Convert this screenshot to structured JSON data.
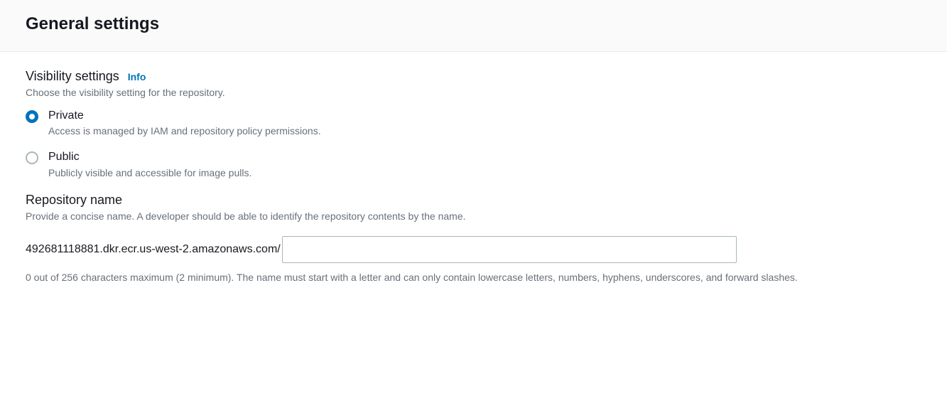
{
  "header": {
    "title": "General settings"
  },
  "visibility": {
    "label": "Visibility settings",
    "info_link": "Info",
    "description": "Choose the visibility setting for the repository.",
    "options": [
      {
        "label": "Private",
        "description": "Access is managed by IAM and repository policy permissions.",
        "selected": true
      },
      {
        "label": "Public",
        "description": "Publicly visible and accessible for image pulls.",
        "selected": false
      }
    ]
  },
  "repository_name": {
    "label": "Repository name",
    "description": "Provide a concise name. A developer should be able to identify the repository contents by the name.",
    "prefix": "492681118881.dkr.ecr.us-west-2.amazonaws.com/",
    "value": "",
    "hint": "0 out of 256 characters maximum (2 minimum). The name must start with a letter and can only contain lowercase letters, numbers, hyphens, underscores, and forward slashes."
  }
}
